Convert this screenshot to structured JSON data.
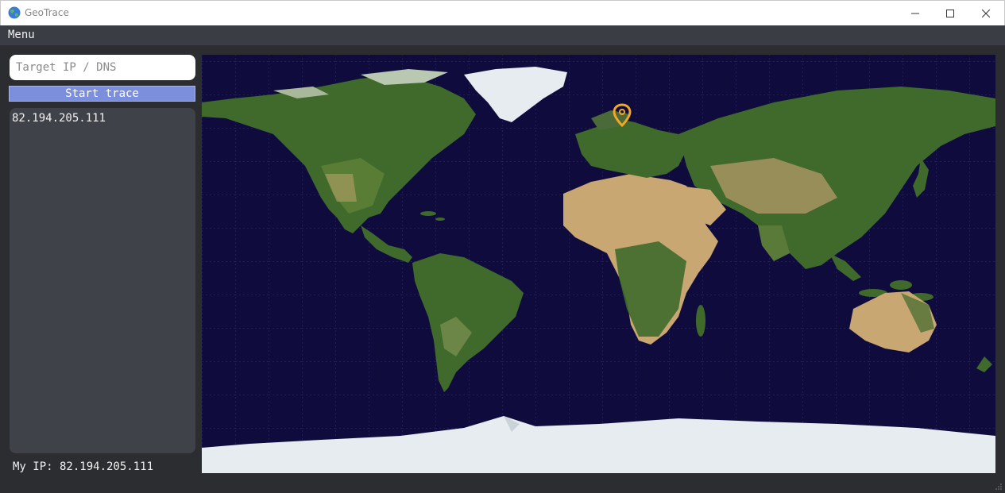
{
  "window": {
    "title": "GeoTrace",
    "icon": "globe-icon",
    "controls": [
      "minimize-icon",
      "maximize-icon",
      "close-icon"
    ]
  },
  "menubar": {
    "items": [
      {
        "label": "Menu"
      }
    ]
  },
  "search": {
    "placeholder": "Target IP / DNS",
    "value": ""
  },
  "trace": {
    "button_label": "Start trace",
    "hops": [
      "82.194.205.111"
    ]
  },
  "status": {
    "my_ip_label": "My IP: 82.194.205.111"
  },
  "map": {
    "marker_icon": "location-pin-icon",
    "colors": {
      "ocean": "#0f0c3d",
      "land": "#3f6a2c",
      "desert": "#c8a772",
      "ice": "#e6ecef",
      "marker": "#f5a623",
      "accent_button": "#7b8fdc"
    }
  }
}
